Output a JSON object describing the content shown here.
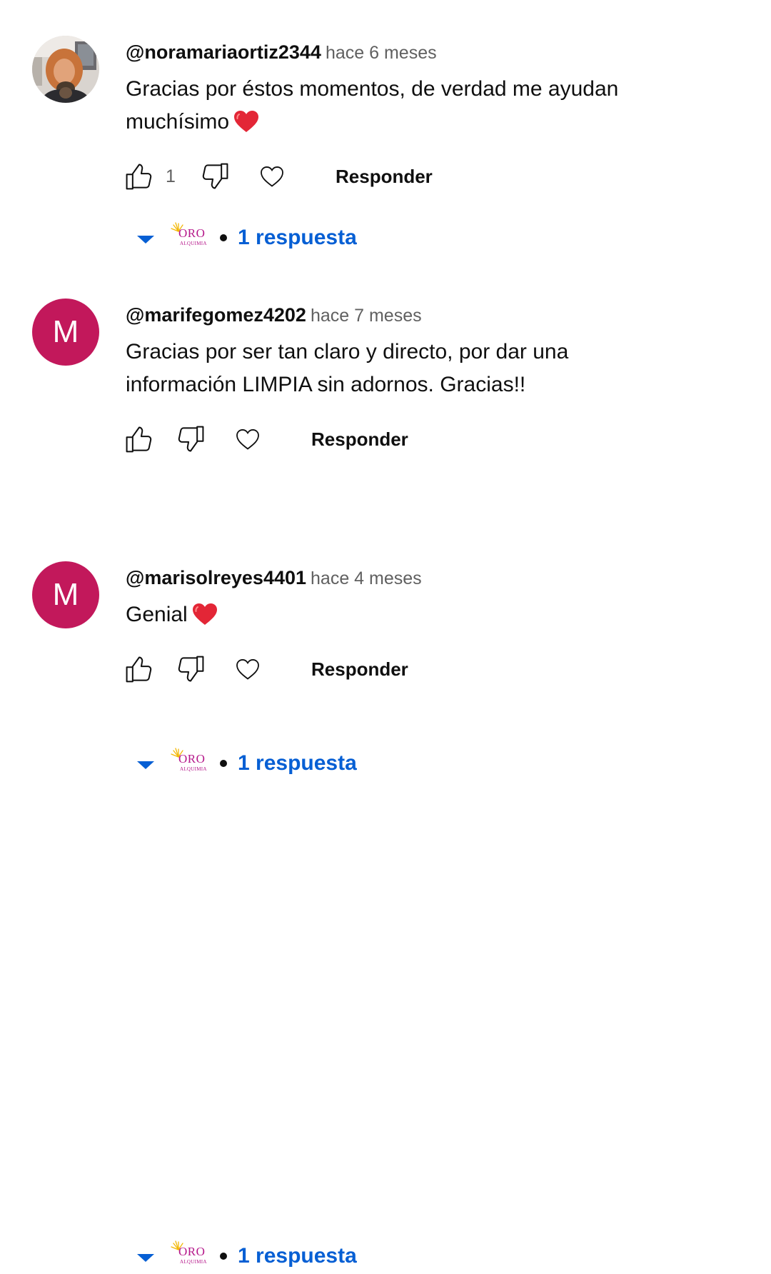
{
  "theme": {
    "accent": "#065fd4",
    "secondary_text": "#606060",
    "primary_text": "#0f0f0f",
    "avatar_bg": "#c2185b",
    "creator_logo_color": "#b5178a",
    "creator_logo_sun": "#f2b705"
  },
  "comments": [
    {
      "author": "@noramariaortiz2344",
      "time": "hace 6 meses",
      "avatar": {
        "type": "photo"
      },
      "text_line1": "Gracias por éstos momentos, de verdad me ayudan",
      "text_line2": "muchísimo",
      "emoji": "heart-emoji",
      "like_count": "1",
      "reply_label": "Responder",
      "creator_logo": {
        "word": "ORO",
        "sub": "ALQUIMIA"
      },
      "replies_label": "1 respuesta"
    },
    {
      "author": "@marifegomez4202",
      "time": "hace 7 meses",
      "avatar": {
        "type": "letter",
        "letter": "M"
      },
      "text_line1": "Gracias por ser tan claro y directo, por dar una",
      "text_line2": "información LIMPIA sin adornos. Gracias!!",
      "like_count": "",
      "reply_label": "Responder",
      "creator_logo": {
        "word": "ORO",
        "sub": "ALQUIMIA"
      },
      "replies_label": "1 respuesta"
    },
    {
      "author": "@marisolreyes4401",
      "time": "hace 4 meses",
      "avatar": {
        "type": "letter",
        "letter": "M"
      },
      "text_line1": "Genial",
      "emoji": "heart-emoji",
      "like_count": "",
      "reply_label": "Responder",
      "creator_logo": {
        "word": "ORO",
        "sub": "ALQUIMIA"
      },
      "replies_label": "1 respuesta"
    }
  ]
}
